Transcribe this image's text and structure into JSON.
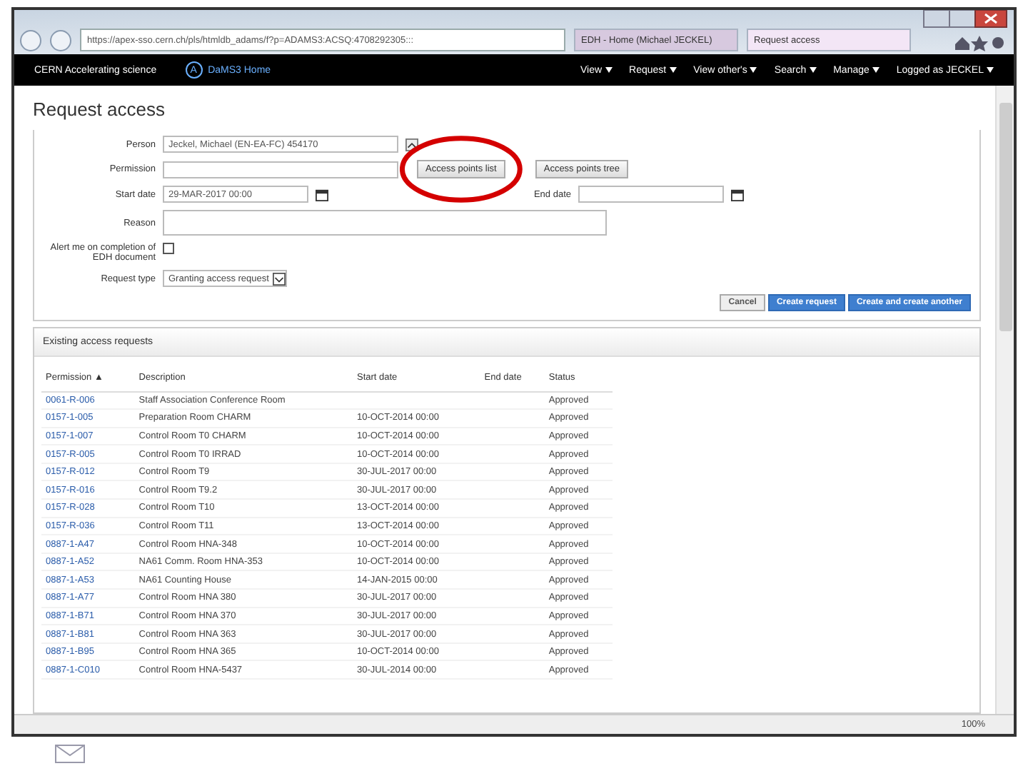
{
  "browser": {
    "address": "https://apex-sso.cern.ch/pls/htmldb_adams/f?p=ADAMS3:ACSQ:4708292305:::",
    "tabs": [
      {
        "label": "EDH - Home (Michael JECKEL)",
        "selected": false
      },
      {
        "label": "Request access",
        "selected": true
      }
    ],
    "zoom": "100%"
  },
  "navbar": {
    "brand": "CERN Accelerating science",
    "logo_letter": "A",
    "home": "DaMS3 Home",
    "menus": [
      "View",
      "Request",
      "View other's",
      "Search",
      "Manage",
      "Logged as JECKEL"
    ]
  },
  "page_title": "Request access",
  "form": {
    "person": {
      "label": "Person",
      "value": "Jeckel, Michael (EN-EA-FC) 454170"
    },
    "permission": {
      "label": "Permission",
      "buttons": [
        "Access points list",
        "Access points tree"
      ]
    },
    "start_date": {
      "label": "Start date",
      "value": "29-MAR-2017 00:00"
    },
    "end_date": {
      "label": "End date"
    },
    "reason": {
      "label": "Reason"
    },
    "alert": {
      "label": "Alert me on completion of EDH document",
      "checked": false
    },
    "request_type": {
      "label": "Request type",
      "value": "Granting access request"
    },
    "actions": [
      {
        "label": "Cancel",
        "kind": "secondary"
      },
      {
        "label": "Create request",
        "kind": "primary"
      },
      {
        "label": "Create and create another",
        "kind": "primary"
      }
    ]
  },
  "existing": {
    "title": "Existing access requests",
    "columns": [
      {
        "label": "Permission",
        "sort": "▲"
      },
      {
        "label": "Description"
      },
      {
        "label": "Start date"
      },
      {
        "label": "End date"
      },
      {
        "label": "Status"
      }
    ],
    "rows": [
      [
        "0061-R-006",
        "Staff Association Conference Room",
        "",
        "",
        "Approved"
      ],
      [
        "0157-1-005",
        "Preparation Room CHARM",
        "10-OCT-2014 00:00",
        "",
        "Approved"
      ],
      [
        "0157-1-007",
        "Control Room T0 CHARM",
        "10-OCT-2014 00:00",
        "",
        "Approved"
      ],
      [
        "0157-R-005",
        "Control Room T0 IRRAD",
        "10-OCT-2014 00:00",
        "",
        "Approved"
      ],
      [
        "0157-R-012",
        "Control Room T9",
        "30-JUL-2017 00:00",
        "",
        "Approved"
      ],
      [
        "0157-R-016",
        "Control Room T9.2",
        "30-JUL-2017 00:00",
        "",
        "Approved"
      ],
      [
        "0157-R-028",
        "Control Room T10",
        "13-OCT-2014 00:00",
        "",
        "Approved"
      ],
      [
        "0157-R-036",
        "Control Room T11",
        "13-OCT-2014 00:00",
        "",
        "Approved"
      ],
      [
        "0887-1-A47",
        "Control Room HNA-348",
        "10-OCT-2014 00:00",
        "",
        "Approved"
      ],
      [
        "0887-1-A52",
        "NA61 Comm. Room HNA-353",
        "10-OCT-2014 00:00",
        "",
        "Approved"
      ],
      [
        "0887-1-A53",
        "NA61 Counting House",
        "14-JAN-2015 00:00",
        "",
        "Approved"
      ],
      [
        "0887-1-A77",
        "Control Room HNA 380",
        "30-JUL-2017 00:00",
        "",
        "Approved"
      ],
      [
        "0887-1-B71",
        "Control Room HNA 370",
        "30-JUL-2017 00:00",
        "",
        "Approved"
      ],
      [
        "0887-1-B81",
        "Control Room HNA 363",
        "30-JUL-2017 00:00",
        "",
        "Approved"
      ],
      [
        "0887-1-B95",
        "Control Room HNA 365",
        "10-OCT-2014 00:00",
        "",
        "Approved"
      ],
      [
        "0887-1-C010",
        "Control Room HNA-5437",
        "30-JUL-2014 00:00",
        "",
        "Approved"
      ]
    ]
  }
}
